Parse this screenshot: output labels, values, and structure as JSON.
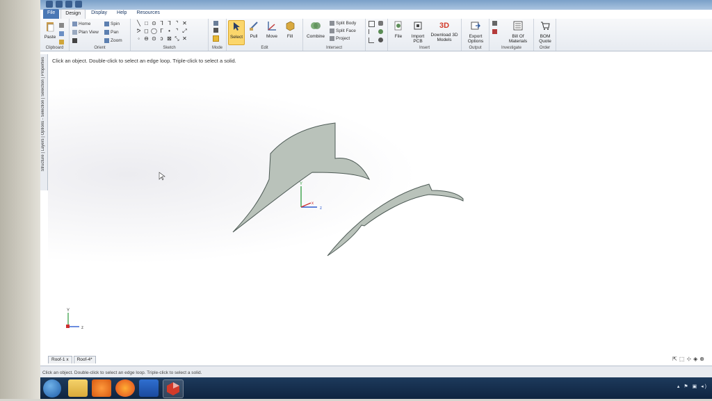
{
  "ribbon": {
    "tabs": [
      "File",
      "Design",
      "Display",
      "Help",
      "Resources"
    ],
    "active_tab": "Design",
    "groups": {
      "clipboard": {
        "label": "Clipboard",
        "paste": "Paste"
      },
      "orient": {
        "label": "Orient",
        "home": "Home",
        "plan_view": "Plan View",
        "spin": "Spin",
        "pan": "Pan",
        "zoom": "Zoom"
      },
      "sketch": {
        "label": "Sketch"
      },
      "mode": {
        "label": "Mode"
      },
      "edit": {
        "label": "Edit",
        "select": "Select",
        "pull": "Pull",
        "move": "Move",
        "fill": "Fill"
      },
      "intersect": {
        "label": "Intersect",
        "combine": "Combine",
        "split_body": "Split Body",
        "split_face": "Split Face",
        "project": "Project"
      },
      "insert": {
        "label": "Insert",
        "file": "File",
        "import_pcb_1": "Import",
        "import_pcb_2": "PCB",
        "download_1": "Download 3D",
        "download_2": "Models",
        "badge_3d": "3D"
      },
      "output": {
        "label": "Output",
        "export_1": "Export",
        "export_2": "Options"
      },
      "investigate": {
        "label": "Investigate",
        "bom_1": "Bill Of",
        "bom_2": "Materials"
      },
      "order": {
        "label": "Order",
        "quote_1": "BOM",
        "quote_2": "Quote"
      }
    }
  },
  "side_panel": {
    "tabs": "Structure | Layers | Options - Selection | Selection | Properties"
  },
  "canvas": {
    "hint": "Click an object. Double-click to select an edge loop. Triple-click to select a solid.",
    "axis_labels": {
      "x": "x",
      "y": "Y",
      "z": "z"
    },
    "small_axis": {
      "y": "Y",
      "z": "z"
    }
  },
  "document_tabs": [
    {
      "label": "Roof-1",
      "close": "x"
    },
    {
      "label": "Roof-4*"
    }
  ],
  "status_bar": {
    "message": "Click an object. Double-click to select an edge loop. Triple-click to select a solid."
  },
  "colors": {
    "shape_fill": "#b9c2ba",
    "shape_stroke": "#4d5a55",
    "ribbon_accent": "#4a78b5",
    "taskbar": "#1d3a5c"
  }
}
